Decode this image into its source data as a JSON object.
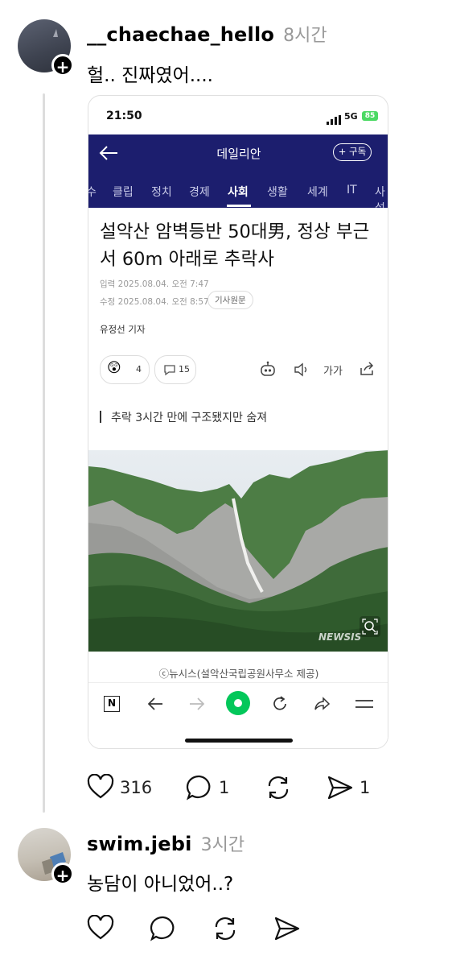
{
  "post1": {
    "username": "__chaechae_hello",
    "time": "8시간",
    "text": "헐.. 진짜였어....",
    "likes": "316",
    "comments": "1",
    "shares": "1"
  },
  "screenshot": {
    "status_time": "21:50",
    "network": "5G",
    "battery": "85",
    "site_title": "데일리안",
    "subscribe_label": "+ 구독",
    "categories": [
      "수",
      "클립",
      "정치",
      "경제",
      "사회",
      "생활",
      "세계",
      "IT",
      "사설"
    ],
    "active_category": "사회",
    "headline_line1": "설악산 암벽등반 50대男, 정상 부근",
    "headline_line2": "서 60m 아래로 추락사",
    "input_date": "입력 2025.08.04. 오전 7:47",
    "edit_date": "수정 2025.08.04. 오전 8:57",
    "original_label": "기사원문",
    "reporter": "유정선 기자",
    "reaction_count": "4",
    "comment_count": "15",
    "font_size_label": "가가",
    "subtitle": "추락 3시간 만에 구조됐지만 숨져",
    "photo_watermark": "NEWSIS",
    "caption": "ⓒ뉴시스(설악산국립공원사무소 제공)"
  },
  "post2": {
    "username": "swim.jebi",
    "time": "3시간",
    "text": "농담이 아니었어..?"
  },
  "colors": {
    "navbar": "#1c1e6e",
    "naver_green": "#03c75a",
    "battery_green": "#4cd964"
  }
}
